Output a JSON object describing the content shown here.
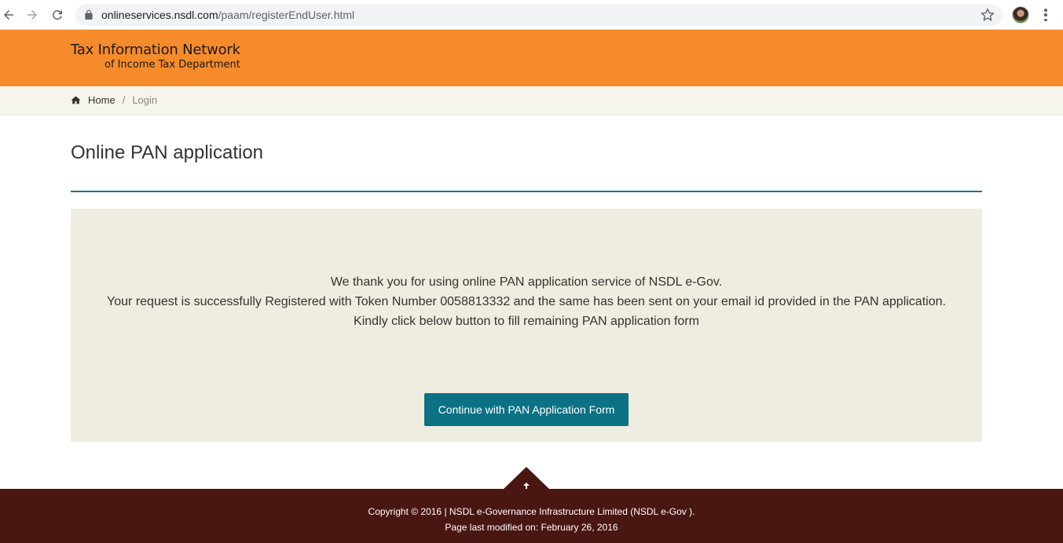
{
  "browser": {
    "url_host": "onlineservices.nsdl.com",
    "url_path": "/paam/registerEndUser.html"
  },
  "header": {
    "logo_line1": "Tax Information Network",
    "logo_line2": "of Income Tax Department"
  },
  "breadcrumb": {
    "home": "Home",
    "separator": "/",
    "current": "Login"
  },
  "main": {
    "title": "Online PAN application",
    "message_lines": [
      "We thank you for using online PAN application service of NSDL e-Gov.",
      "Your request is successfully Registered with Token Number 0058813332 and the same has been sent on your email id provided in the PAN application.",
      "Kindly click below button to fill remaining PAN application form"
    ],
    "continue_button": "Continue with PAN Application Form"
  },
  "footer": {
    "copyright": "Copyright © 2016 | NSDL e-Governance Infrastructure Limited (NSDL e-Gov ).",
    "last_modified": "Page last modified on: February 26, 2016"
  },
  "colors": {
    "header_orange": "#f58b2b",
    "breadcrumb_bg": "#f5f5ec",
    "panel_bg": "#efeddf",
    "button_teal": "#0b7285",
    "footer_maroon": "#4a1612",
    "title_rule_blue": "#1d6f9a"
  },
  "icons": [
    "back-arrow-icon",
    "forward-arrow-icon",
    "reload-icon",
    "lock-icon",
    "star-icon",
    "profile-avatar",
    "more-menu-icon",
    "home-icon",
    "arrow-up-icon"
  ]
}
